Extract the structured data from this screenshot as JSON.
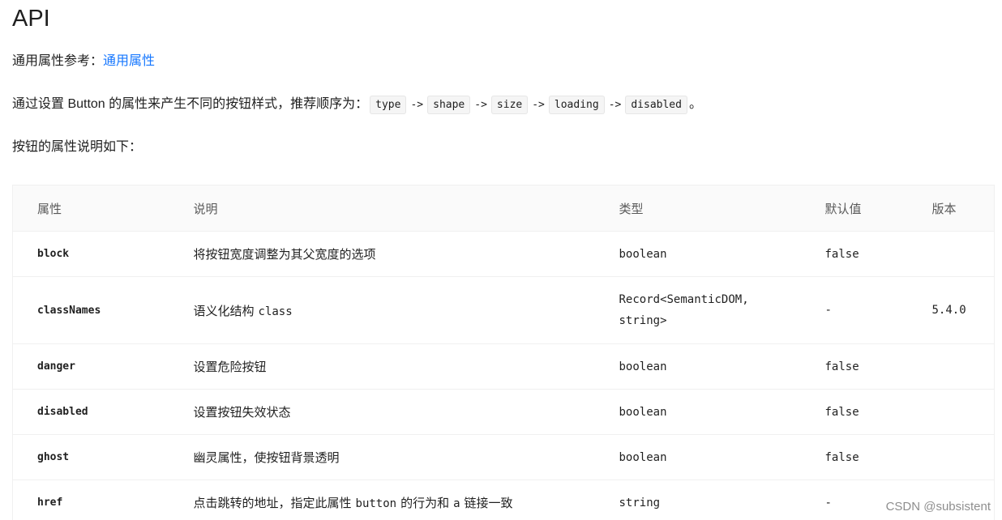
{
  "heading": "API",
  "common_props": {
    "label": "通用属性参考：",
    "link_text": "通用属性"
  },
  "intro": {
    "prefix": "通过设置 Button 的属性来产生不同的按钮样式，推荐顺序为：",
    "sequence": [
      "type",
      "shape",
      "size",
      "loading",
      "disabled"
    ],
    "arrow": "->",
    "suffix": "。"
  },
  "table_intro": "按钮的属性说明如下：",
  "table": {
    "headers": [
      "属性",
      "说明",
      "类型",
      "默认值",
      "版本"
    ],
    "rows": [
      {
        "prop": "block",
        "desc": "将按钮宽度调整为其父宽度的选项",
        "type": "boolean",
        "default": "false",
        "version": ""
      },
      {
        "prop": "classNames",
        "desc_prefix": "语义化结构",
        "desc_code": "class",
        "desc_suffix": "",
        "type_line1": "Record<SemanticDOM,",
        "type_line2": "string>",
        "default": "-",
        "version": "5.4.0"
      },
      {
        "prop": "danger",
        "desc": "设置危险按钮",
        "type": "boolean",
        "default": "false",
        "version": ""
      },
      {
        "prop": "disabled",
        "desc": "设置按钮失效状态",
        "type": "boolean",
        "default": "false",
        "version": ""
      },
      {
        "prop": "ghost",
        "desc": "幽灵属性，使按钮背景透明",
        "type": "boolean",
        "default": "false",
        "version": ""
      },
      {
        "prop": "href",
        "desc_prefix": "点击跳转的地址，指定此属性",
        "desc_code": "button",
        "desc_mid": "的行为和",
        "desc_code2": "a",
        "desc_suffix": "链接一致",
        "type": "string",
        "default": "-",
        "version": ""
      }
    ]
  },
  "watermark": "CSDN @subsistent",
  "colors": {
    "link": "#1677ff",
    "type": "#c41d7f",
    "header_bg": "#fafafa",
    "border": "#f0f0f0"
  }
}
